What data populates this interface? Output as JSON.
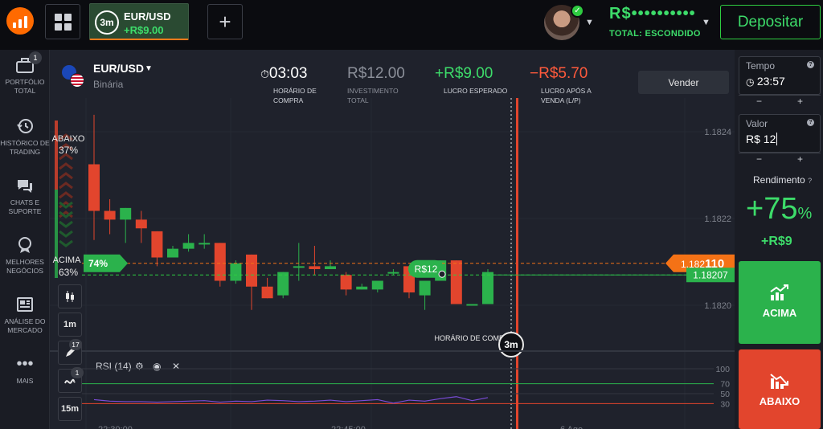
{
  "topbar": {
    "asset_tab": {
      "timer": "3m",
      "name": "EUR/USD",
      "profit": "+R$9.00"
    },
    "balance": "R$••••••••••",
    "balance_label": "TOTAL: ESCONDIDO",
    "deposit_label": "Depositar"
  },
  "sidebar": {
    "items": [
      {
        "label": "PORTFÓLIO TOTAL",
        "icon": "briefcase-icon",
        "badge": "1"
      },
      {
        "label": "HISTÓRICO DE TRADING",
        "icon": "history-icon"
      },
      {
        "label": "CHATS E SUPORTE",
        "icon": "chat-icon"
      },
      {
        "label": "MELHORES NEGÓCIOS",
        "icon": "medal-icon"
      },
      {
        "label": "ANÁLISE DO MERCADO",
        "icon": "newspaper-icon"
      },
      {
        "label": "MAIS",
        "icon": "more-icon"
      }
    ]
  },
  "header": {
    "pair": "EUR/USD",
    "type": "Binária",
    "time": "03:03",
    "time_label": "HORÁRIO DE COMPRA",
    "investment": "R$12.00",
    "investment_label": "INVESTIMENTO TOTAL",
    "expected": "+R$9.00",
    "expected_label": "LUCRO ESPERADO",
    "after_sale": "−R$5.70",
    "after_sale_label": "LUCRO APÓS A VENDA (L/P)",
    "sell_label": "Vender"
  },
  "chart": {
    "price_ticks": [
      "1.1824",
      "1.1822",
      "1.1820"
    ],
    "current_price_prefix": "1.182",
    "current_price_suffix": "110",
    "open_price": "1.18207",
    "down_label": "ABAIXO",
    "down_pct": "37%",
    "up_label": "ACIMA",
    "up_pct": "63%",
    "up_tag": "74%",
    "trade_tag": "R$12",
    "expiry_label": "HORÁRIO DE COMPRA",
    "expiry_timer": "3m",
    "rsi_label": "RSI (14)",
    "rsi_levels": [
      "100",
      "70",
      "50",
      "30"
    ],
    "time_axis": [
      "22:30:00",
      "22:45:00",
      "6 Ago"
    ],
    "colors": {
      "up": "#2bb24c",
      "down": "#e2452d",
      "open_line": "#2ecc40",
      "price_line": "#f47216",
      "rsi": "#7b4cd8"
    }
  },
  "chart_data": {
    "type": "candlestick",
    "candles": [
      {
        "o": 1.18245,
        "h": 1.18262,
        "l": 1.18219,
        "c": 1.18229
      },
      {
        "o": 1.18229,
        "h": 1.18233,
        "l": 1.18221,
        "c": 1.18226
      },
      {
        "o": 1.18226,
        "h": 1.1823,
        "l": 1.18218,
        "c": 1.1823
      },
      {
        "o": 1.18226,
        "h": 1.18229,
        "l": 1.18218,
        "c": 1.18223
      },
      {
        "o": 1.18222,
        "h": 1.18222,
        "l": 1.1821,
        "c": 1.18213
      },
      {
        "o": 1.18213,
        "h": 1.18217,
        "l": 1.18213,
        "c": 1.18216
      },
      {
        "o": 1.18216,
        "h": 1.18221,
        "l": 1.18215,
        "c": 1.18218
      },
      {
        "o": 1.18218,
        "h": 1.18221,
        "l": 1.18216,
        "c": 1.18218
      },
      {
        "o": 1.18218,
        "h": 1.18218,
        "l": 1.18203,
        "c": 1.18205
      },
      {
        "o": 1.18205,
        "h": 1.18212,
        "l": 1.18204,
        "c": 1.18211
      },
      {
        "o": 1.18214,
        "h": 1.18214,
        "l": 1.18195,
        "c": 1.18203
      },
      {
        "o": 1.18203,
        "h": 1.18206,
        "l": 1.18199,
        "c": 1.18199
      },
      {
        "o": 1.182,
        "h": 1.18208,
        "l": 1.18199,
        "c": 1.18208
      },
      {
        "o": 1.1821,
        "h": 1.18218,
        "l": 1.18205,
        "c": 1.1821
      },
      {
        "o": 1.1821,
        "h": 1.18217,
        "l": 1.18207,
        "c": 1.18209
      },
      {
        "o": 1.18209,
        "h": 1.18212,
        "l": 1.18209,
        "c": 1.1821
      },
      {
        "o": 1.18207,
        "h": 1.18208,
        "l": 1.182,
        "c": 1.18202
      },
      {
        "o": 1.18202,
        "h": 1.18204,
        "l": 1.18202,
        "c": 1.18203
      },
      {
        "o": 1.18202,
        "h": 1.18205,
        "l": 1.18201,
        "c": 1.18205
      },
      {
        "o": 1.18208,
        "h": 1.18209,
        "l": 1.18207,
        "c": 1.18208
      },
      {
        "o": 1.1821,
        "h": 1.1821,
        "l": 1.18199,
        "c": 1.18201
      },
      {
        "o": 1.182,
        "h": 1.18205,
        "l": 1.18195,
        "c": 1.18205
      },
      {
        "o": 1.18205,
        "h": 1.18212,
        "l": 1.18205,
        "c": 1.18212
      },
      {
        "o": 1.18212,
        "h": 1.18212,
        "l": 1.18197,
        "c": 1.18197
      },
      {
        "o": 1.18197,
        "h": 1.18197,
        "l": 1.18197,
        "c": 1.18197
      },
      {
        "o": 1.18197,
        "h": 1.18209,
        "l": 1.18197,
        "c": 1.18208
      }
    ],
    "open_price": 1.18207,
    "current_price": 1.18211,
    "rsi_values": [
      38,
      35,
      34,
      34,
      33,
      34,
      35,
      36,
      33,
      35,
      34,
      37,
      36,
      34,
      35,
      37,
      34,
      36,
      38,
      31,
      37,
      35,
      40,
      44,
      36,
      42
    ],
    "rsi_range": [
      0,
      100
    ],
    "price_range": [
      1.18185,
      1.18265
    ]
  },
  "panel": {
    "time_label": "Tempo",
    "time_value": "23:57",
    "amount_label": "Valor",
    "amount_value": "R$ 12",
    "yield_label": "Rendimento",
    "yield_value": "+75",
    "yield_unit": "%",
    "yield_profit": "+R$9",
    "call_label": "ACIMA",
    "put_label": "ABAIXO"
  },
  "tools": {
    "timeframe_1": "1m",
    "timeframe_2": "15m",
    "draw_badge": "17",
    "indicator_badge": "1"
  }
}
